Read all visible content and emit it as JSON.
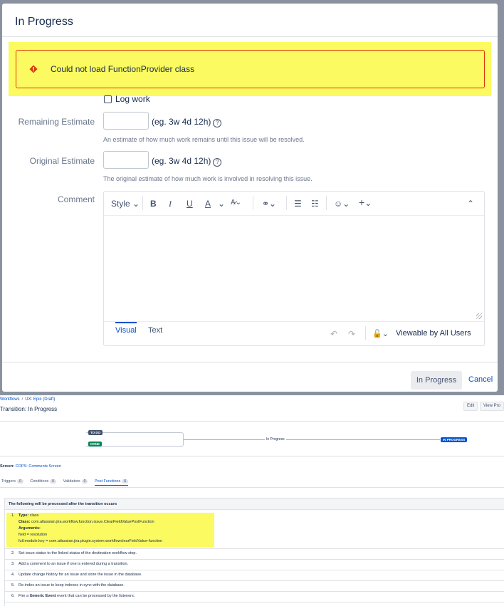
{
  "dialog": {
    "title": "In Progress",
    "error": "Could not load FunctionProvider class",
    "log_work_label": "Log work",
    "remaining": {
      "label": "Remaining Estimate",
      "hint": "(eg. 3w 4d 12h)",
      "desc": "An estimate of how much work remains until this issue will be resolved."
    },
    "original": {
      "label": "Original Estimate",
      "hint": "(eg. 3w 4d 12h)",
      "desc": "The original estimate of how much work is involved in resolving this issue."
    },
    "comment": {
      "label": "Comment",
      "toolbar": {
        "style": "Style"
      },
      "tabs": [
        "Visual",
        "Text"
      ],
      "visibility": "Viewable by All Users"
    },
    "buttons": {
      "submit": "In Progress",
      "cancel": "Cancel"
    }
  },
  "page": {
    "breadcrumb": [
      "Workflows",
      "UX: Epic (Draft)"
    ],
    "title": "Transition: In Progress",
    "actions": [
      "Edit",
      "View Pro"
    ],
    "workflow": {
      "from_todo": "TO DO",
      "from_done": "DONE",
      "transition": "In Progress",
      "to": "IN PROGRESS"
    },
    "screen_label": "Screen:",
    "screen_value": "COPS: Comments Screen",
    "tabs": [
      {
        "label": "Triggers",
        "count": "0"
      },
      {
        "label": "Conditions",
        "count": "0"
      },
      {
        "label": "Validators",
        "count": "0"
      },
      {
        "label": "Post Functions",
        "count": "6"
      }
    ],
    "post_functions_header": "The following will be processed after the transition occurs",
    "pf1": {
      "num": "1.",
      "type_label": "Type:",
      "type_value": "class",
      "class_label": "Class:",
      "class_value": "com.atlassian.jira.workflow.function.issue.ClearFieldValuePostFunction",
      "args_label": "Arguments:",
      "arg1": "field = resolution",
      "arg2": "full.module.key = com.atlassian.jira.plugin.system.workflowclearFieldValue-function"
    },
    "items": [
      {
        "num": "2.",
        "text": "Set issue status to the linked status of the destination workflow step."
      },
      {
        "num": "3.",
        "text": "Add a comment to an issue if one is entered during a transition."
      },
      {
        "num": "4.",
        "text": "Update change history for an issue and store the issue in the database."
      },
      {
        "num": "5.",
        "text": "Re-index an issue to keep indexes in sync with the database."
      }
    ],
    "pf6": {
      "num": "6.",
      "pre": "Fire a",
      "bold": "Generic Event",
      "post": "event that can be processed by the listeners."
    }
  },
  "colors": {
    "highlight": "#fbfa60",
    "error_border": "#de350b",
    "link": "#0052cc",
    "todo_lozenge": "#42526e",
    "done_lozenge": "#00875a",
    "inprogress_lozenge": "#0052cc"
  },
  "icons": [
    "error-icon",
    "help-icon",
    "bold-icon",
    "italic-icon",
    "underline-icon",
    "text-color-icon",
    "link-icon",
    "bullet-list-icon",
    "numbered-list-icon",
    "emoji-icon",
    "plus-icon",
    "collapse-icon",
    "undo-icon",
    "redo-icon",
    "unlock-icon"
  ]
}
